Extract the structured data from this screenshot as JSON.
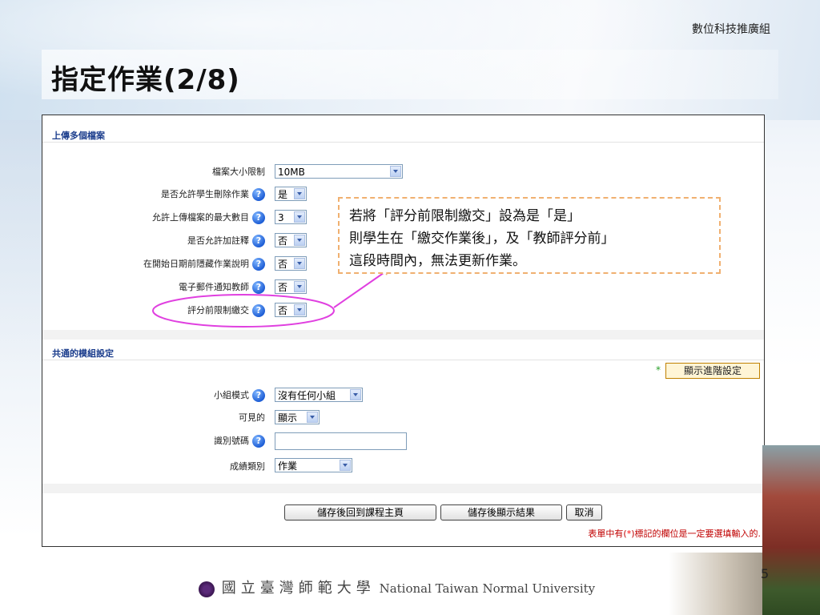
{
  "org_name": "數位科技推廣組",
  "slide_title": "指定作業(2/8)",
  "section1": {
    "title": "上傳多個檔案",
    "rows": [
      {
        "label": "檔案大小限制",
        "value": "10MB",
        "help": false
      },
      {
        "label": "是否允許學生刪除作業",
        "value": "是",
        "help": true
      },
      {
        "label": "允許上傳檔案的最大數目",
        "value": "3",
        "help": true
      },
      {
        "label": "是否允許加註釋",
        "value": "否",
        "help": true
      },
      {
        "label": "在開始日期前隱藏作業說明",
        "value": "否",
        "help": true
      },
      {
        "label": "電子郵件通知教師",
        "value": "否",
        "help": true
      },
      {
        "label": "評分前限制繳交",
        "value": "否",
        "help": true
      }
    ]
  },
  "section2": {
    "title": "共通的模組設定",
    "advanced_button": "顯示進階設定",
    "rows": [
      {
        "label": "小組模式",
        "value": "沒有任何小組",
        "help": true
      },
      {
        "label": "可見的",
        "value": "顯示",
        "help": false
      },
      {
        "label": "識別號碼",
        "value": "",
        "help": true
      },
      {
        "label": "成績類別",
        "value": "作業",
        "help": false
      }
    ]
  },
  "buttons": {
    "save_return": "儲存後回到課程主頁",
    "save_display": "儲存後顯示結果",
    "cancel": "取消"
  },
  "required_note_parts": [
    "表單中有(",
    "*",
    ")標記的欄位是一定要選填輸入的."
  ],
  "callout_lines": [
    "若將「評分前限制繳交」設為是「是」",
    "則學生在「繳交作業後」，及「教師評分前」",
    "這段時間內，無法更新作業。"
  ],
  "footer": {
    "cn": "國立臺灣師範大學",
    "en": "National Taiwan Normal University"
  },
  "page_number": "5",
  "colors": {
    "section_title": "#1a3c8c",
    "callout_border": "#f0b070",
    "highlight_ellipse": "#e040e0",
    "required_note": "#c00000"
  },
  "icons": {
    "help": "question-circle-icon",
    "dropdown": "chevron-down-icon",
    "emblem": "university-emblem-icon"
  }
}
